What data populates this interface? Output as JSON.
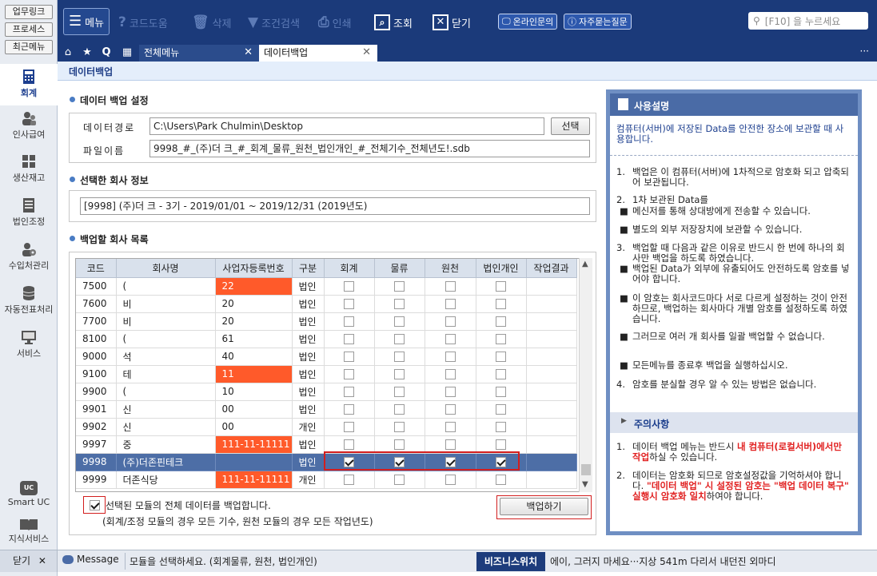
{
  "left_rail": {
    "top_buttons": [
      "업무링크",
      "프로세스",
      "최근메뉴"
    ],
    "items": [
      {
        "label": "회계",
        "icon": "calculator-icon",
        "active": true
      },
      {
        "label": "인사급여",
        "icon": "people-icon",
        "active": false
      },
      {
        "label": "생산재고",
        "icon": "boxes-icon",
        "active": false
      },
      {
        "label": "법인조정",
        "icon": "ledger-icon",
        "active": false
      },
      {
        "label": "수입처관리",
        "icon": "users-gear-icon",
        "active": false
      },
      {
        "label": "자동전표처리",
        "icon": "database-icon",
        "active": false
      },
      {
        "label": "서비스",
        "icon": "monitor-icon",
        "active": false
      }
    ],
    "smart_uc": {
      "badge": "UC",
      "label": "Smart UC"
    },
    "knowledge": {
      "label": "지식서비스"
    }
  },
  "toolbar": {
    "menu_label": "메뉴",
    "code_help": "코드도움",
    "delete": "삭제",
    "filter": "조건검색",
    "print": "인쇄",
    "lookup": "조회",
    "close": "닫기",
    "online_inquiry": "온라인문의",
    "faq": "자주묻는질문",
    "search_placeholder": "[F10] 을 누르세요"
  },
  "tabs": {
    "all_menu": "전체메뉴",
    "data_backup": "데이터백업",
    "more": "···"
  },
  "page": {
    "title": "데이터백업",
    "section_settings": "데이터 백업 설정",
    "data_path_label": "데이터경로",
    "data_path_value": "C:\\Users\\Park Chulmin\\Desktop",
    "select_button": "선택",
    "filename_label": "파일이름",
    "filename_value": "9998_#_(주)더        크_#_회계_물류_원천_법인개인_#_전체기수_전체년도!.sdb",
    "section_company_info": "선택한 회사 정보",
    "company_info_value": "[9998] (주)더        크 - 3기 - 2019/01/01 ~ 2019/12/31 (2019년도)",
    "section_company_list": "백업할 회사 목록",
    "table_headers": [
      "코드",
      "회사명",
      "사업자등록번호",
      "구분",
      "회계",
      "물류",
      "원천",
      "법인개인",
      "작업결과"
    ],
    "rows": [
      {
        "code": "7500",
        "name": "(",
        "bizno": "22",
        "type": "법인",
        "acc": false,
        "log": false,
        "tax": false,
        "corp": false,
        "result": "",
        "masked": true,
        "selected": false
      },
      {
        "code": "7600",
        "name": "비",
        "bizno": "20",
        "type": "법인",
        "acc": false,
        "log": false,
        "tax": false,
        "corp": false,
        "result": "",
        "masked": false,
        "selected": false
      },
      {
        "code": "7700",
        "name": "비",
        "bizno": "20",
        "type": "법인",
        "acc": false,
        "log": false,
        "tax": false,
        "corp": false,
        "result": "",
        "masked": false,
        "selected": false
      },
      {
        "code": "8100",
        "name": "(",
        "bizno": "61",
        "type": "법인",
        "acc": false,
        "log": false,
        "tax": false,
        "corp": false,
        "result": "",
        "masked": false,
        "selected": false
      },
      {
        "code": "9000",
        "name": "석",
        "bizno": "40",
        "type": "법인",
        "acc": false,
        "log": false,
        "tax": false,
        "corp": false,
        "result": "",
        "masked": false,
        "selected": false
      },
      {
        "code": "9100",
        "name": "테",
        "bizno": "11",
        "type": "법인",
        "acc": false,
        "log": false,
        "tax": false,
        "corp": false,
        "result": "",
        "masked": true,
        "selected": false
      },
      {
        "code": "9900",
        "name": "(",
        "bizno": "10",
        "type": "법인",
        "acc": false,
        "log": false,
        "tax": false,
        "corp": false,
        "result": "",
        "masked": false,
        "selected": false
      },
      {
        "code": "9901",
        "name": "신",
        "bizno": "00",
        "type": "법인",
        "acc": false,
        "log": false,
        "tax": false,
        "corp": false,
        "result": "",
        "masked": false,
        "selected": false
      },
      {
        "code": "9902",
        "name": "신",
        "bizno": "00",
        "type": "개인",
        "acc": false,
        "log": false,
        "tax": false,
        "corp": false,
        "result": "",
        "masked": false,
        "selected": false
      },
      {
        "code": "9997",
        "name": "중",
        "bizno": "111-11-11111",
        "type": "법인",
        "acc": false,
        "log": false,
        "tax": false,
        "corp": false,
        "result": "",
        "masked": true,
        "selected": false
      },
      {
        "code": "9998",
        "name": "(주)더존핀테크",
        "bizno": "",
        "type": "법인",
        "acc": true,
        "log": true,
        "tax": true,
        "corp": true,
        "result": "",
        "masked": false,
        "selected": true
      },
      {
        "code": "9999",
        "name": "더존식당",
        "bizno": "111-11-11111",
        "type": "개인",
        "acc": false,
        "log": false,
        "tax": false,
        "corp": false,
        "result": "",
        "masked": true,
        "selected": false
      }
    ],
    "backup_all_checked": true,
    "backup_all_label": "선택된 모듈의 전체 데이터를 백업합니다.",
    "backup_all_note": "(회계/조정 모듈의 경우 모든 기수, 원천 모듈의 경우 모든 작업년도)",
    "backup_button": "백업하기"
  },
  "help": {
    "title": "사용설명",
    "intro": "컴퓨터(서버)에 저장된 Data를 안전한 장소에 보관할 때 사용합니다.",
    "item1": "백업은 이 컴퓨터(서버)에 1차적으로 암호화 되고 압축되어 보관됩니다.",
    "item2": "1차 보관된 Data를",
    "item2a": "메신저를 통해 상대방에게 전송할 수 있습니다.",
    "item2b": "별도의 외부 저장장치에 보관할 수 있습니다.",
    "item3": "백업할 때 다음과 같은 이유로 반드시 한 번에 하나의 회사만 백업을 하도록 하였습니다.",
    "item3a": "백업된 Data가 외부에 유출되어도 안전하도록 암호를 넣어야 합니다.",
    "item3b": "이 암호는 회사코드마다 서로 다르게 설정하는 것이 안전하므로, 백업하는 회사마다 개별 암호를 설정하도록 하였습니다.",
    "item3c": "그러므로 여러 개 회사를 일괄 백업할 수 없습니다.",
    "item3d": "모든메뉴를 종료후 백업을 실행하십시오.",
    "item4": "암호를 분실할 경우 알 수 있는 방법은 없습니다.",
    "warn_title": "주의사항",
    "warn1a": "데이터 백업 메뉴는 반드시 ",
    "warn1b": "내 컴퓨터(로컬서버)에서만 작업",
    "warn1c": "하실 수 있습니다.",
    "warn2a": "데이터는 암호화 되므로 암호설정값을 기억하셔야 합니다. ",
    "warn2b": "\"데이터 백업\" 시 설정된 암호는 \"백업 데이터 복구\" 실행시 암호화 일치",
    "warn2c": "하여야 합니다."
  },
  "status": {
    "close_label": "닫기",
    "message_label": "Message",
    "message_text": "모듈을 선택하세요. (회계물류, 원천, 법인개인)",
    "biz_label": "비즈니스위치",
    "ticker": "에이, 그러지 마세요···지상 541m 다리서 내던진 외마디"
  }
}
